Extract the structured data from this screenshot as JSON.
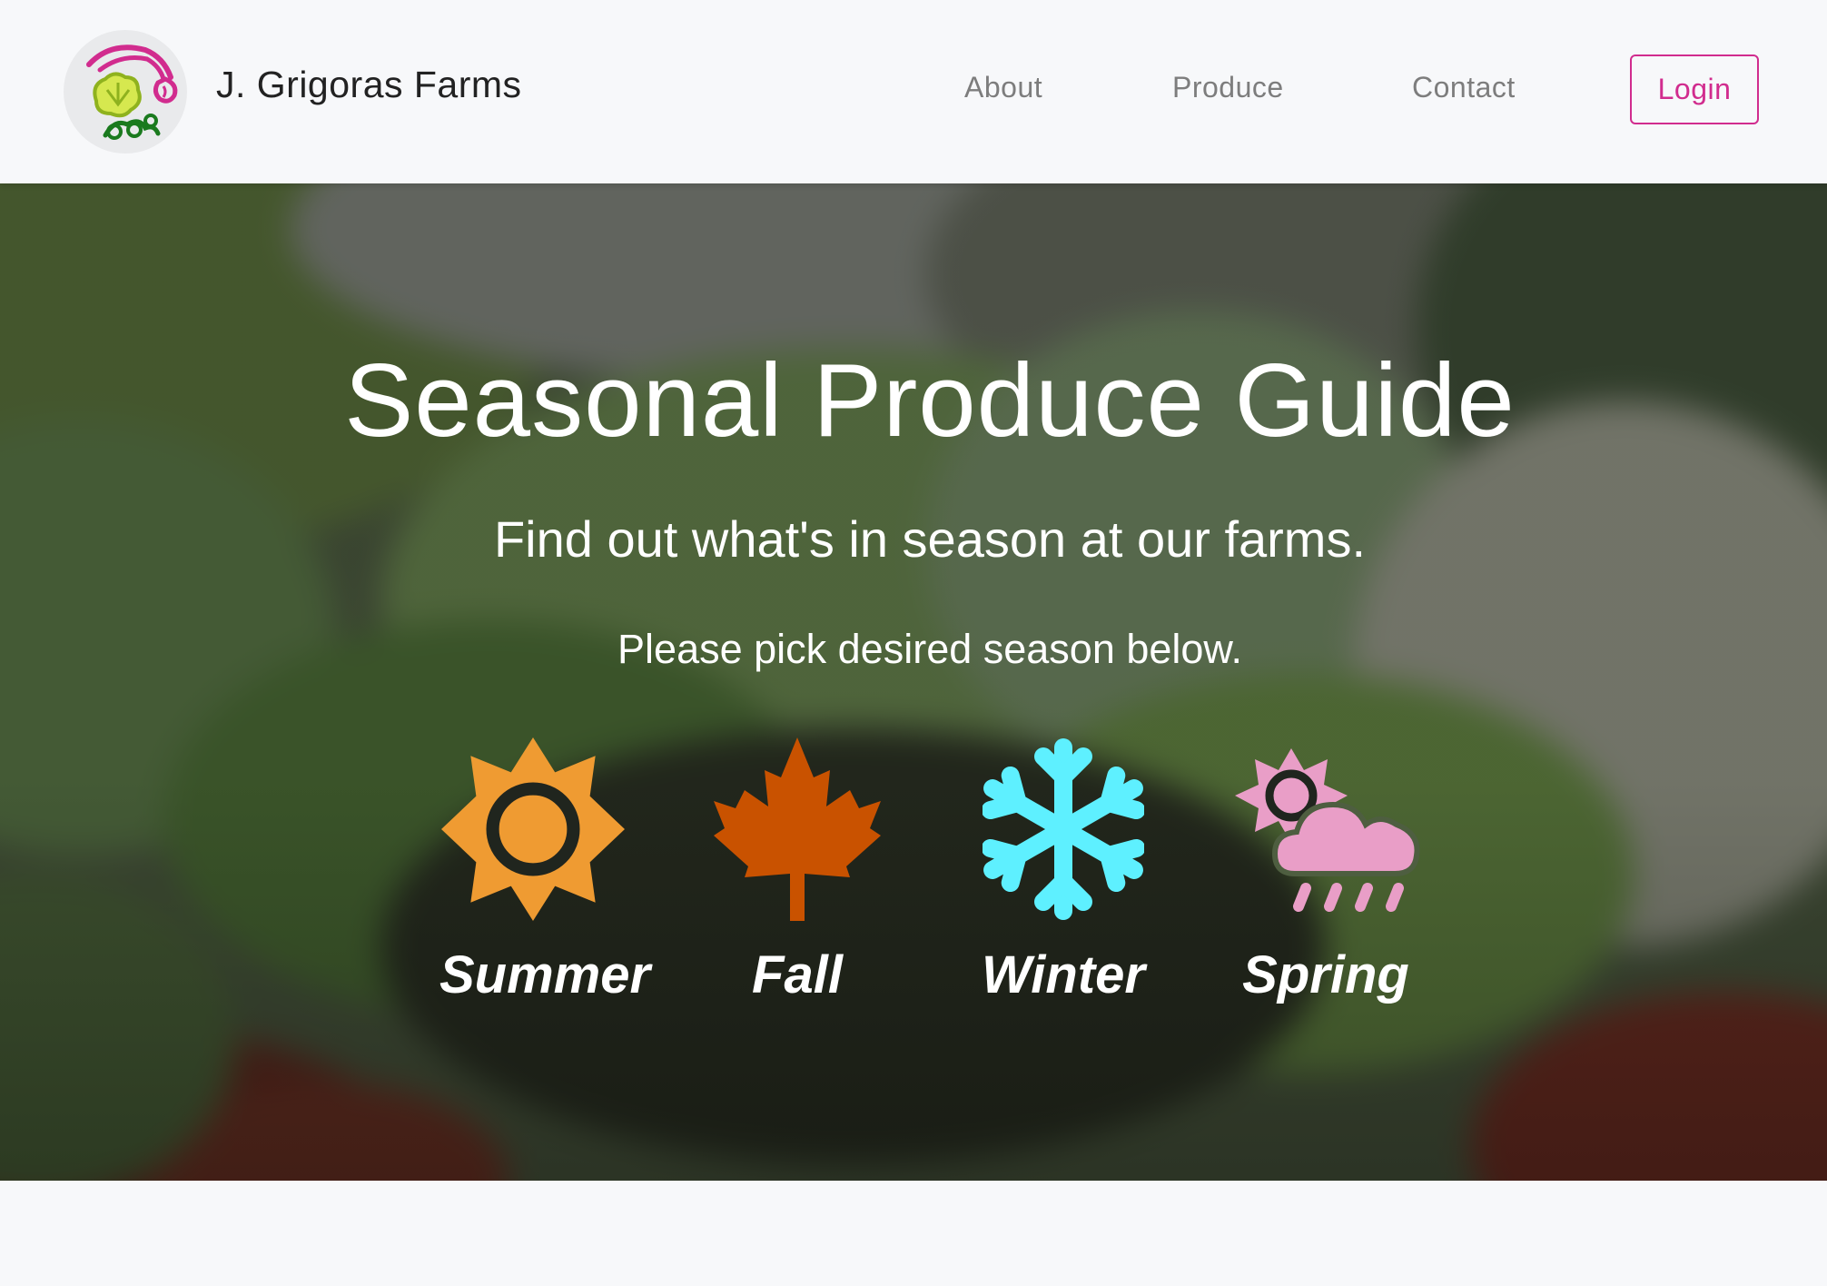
{
  "brand": {
    "name": "J. Grigoras Farms",
    "logo_icon": "farm-produce-logo-icon"
  },
  "nav": {
    "links": [
      {
        "label": "About"
      },
      {
        "label": "Produce"
      },
      {
        "label": "Contact"
      }
    ],
    "login_label": "Login"
  },
  "hero": {
    "title": "Seasonal Produce Guide",
    "subtitle": "Find out what's in season at our farms.",
    "prompt": "Please pick desired season below."
  },
  "seasons": [
    {
      "label": "Summer",
      "icon": "sun-icon",
      "color": "#ef9b32"
    },
    {
      "label": "Fall",
      "icon": "maple-leaf-icon",
      "color": "#c95200"
    },
    {
      "label": "Winter",
      "icon": "snowflake-icon",
      "color": "#5ef0ff"
    },
    {
      "label": "Spring",
      "icon": "sun-cloud-rain-icon",
      "color": "#e99ec7"
    }
  ],
  "colors": {
    "accent": "#d12c8e",
    "nav_text": "#7d7d7d",
    "navbar_bg": "#f7f8fa"
  }
}
